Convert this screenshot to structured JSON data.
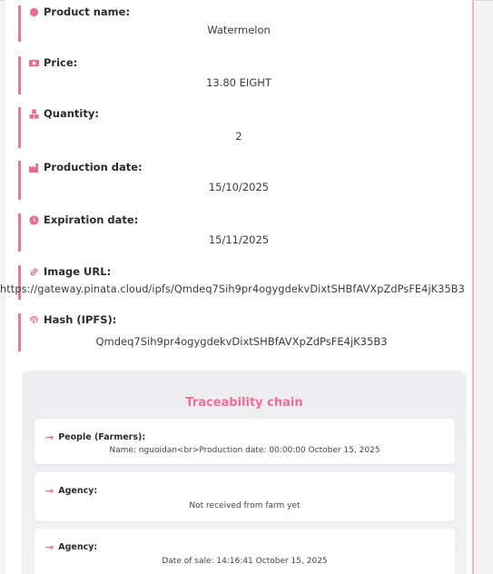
{
  "product": {
    "name_label": "Product name:",
    "name_value": "Watermelon",
    "price_label": "Price:",
    "price_value": "13.80 EIGHT",
    "quantity_label": "Quantity:",
    "quantity_value": "2",
    "production_label": "Production date:",
    "production_value": "15/10/2025",
    "expiration_label": "Expiration date:",
    "expiration_value": "15/11/2025",
    "image_label": "Image URL:",
    "image_value": "https://gateway.pinata.cloud/ipfs/Qmdeq7Sih9pr4ogygdekvDixtSHBfAVXpZdPsFE4jK35B3",
    "hash_label": "Hash (IPFS):",
    "hash_value": "Qmdeq7Sih9pr4ogygdekvDixtSHBfAVXpZdPsFE4jK35B3"
  },
  "chain": {
    "title": "Traceability chain",
    "steps": [
      {
        "label": "People (Farmers):",
        "value": "Name: nguoidan<br>Production date: 00:00:00 October 15, 2025"
      },
      {
        "label": "Agency:",
        "value": "Not received from farm yet"
      },
      {
        "label": "Agency:",
        "value": "Date of sale: 14:16:41 October 15, 2025"
      }
    ]
  },
  "colors": {
    "accent": "#e07b9a",
    "title": "#ea6f95"
  },
  "icons": [
    "circle-icon",
    "money-icon",
    "boxes-icon",
    "factory-icon",
    "clock-icon",
    "link-icon",
    "fingerprint-icon",
    "arrow-right-icon"
  ]
}
